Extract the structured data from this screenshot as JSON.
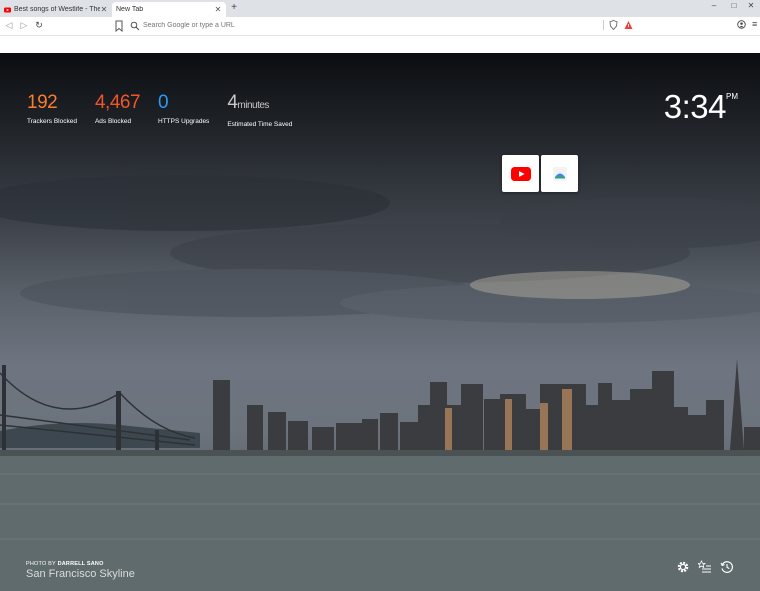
{
  "tabs": [
    {
      "title": "Best songs of Westlife - The gre",
      "active": false,
      "icon": "youtube-icon"
    },
    {
      "title": "New Tab",
      "active": true
    }
  ],
  "new_tab_symbol": "+",
  "window_controls": {
    "minimize": "–",
    "maximize": "□",
    "close": "✕"
  },
  "address_bar": {
    "placeholder": "Search Google or type a URL",
    "value": ""
  },
  "stats": [
    {
      "value": "192",
      "label": "Trackers Blocked",
      "color": "#fb7c2f"
    },
    {
      "value": "4,467",
      "label": "Ads Blocked",
      "color": "#f2552c"
    },
    {
      "value": "0",
      "label": "HTTPS Upgrades",
      "color": "#2d9af5"
    },
    {
      "value": "4",
      "unit": "minutes",
      "label": "Estimated Time Saved",
      "color": "#c7c7c7"
    }
  ],
  "clock": {
    "time": "3:34",
    "ampm": "PM"
  },
  "top_sites": [
    {
      "name": "youtube-tile",
      "icon": "youtube-icon"
    },
    {
      "name": "google-tile",
      "icon": "google-drive-icon"
    }
  ],
  "photo_credit": {
    "prefix": "PHOTO BY",
    "author": "DARRELL SANO",
    "location": "San Francisco Skyline"
  },
  "bottom_icons": [
    "gear-icon",
    "bookmarks-icon",
    "history-icon"
  ]
}
